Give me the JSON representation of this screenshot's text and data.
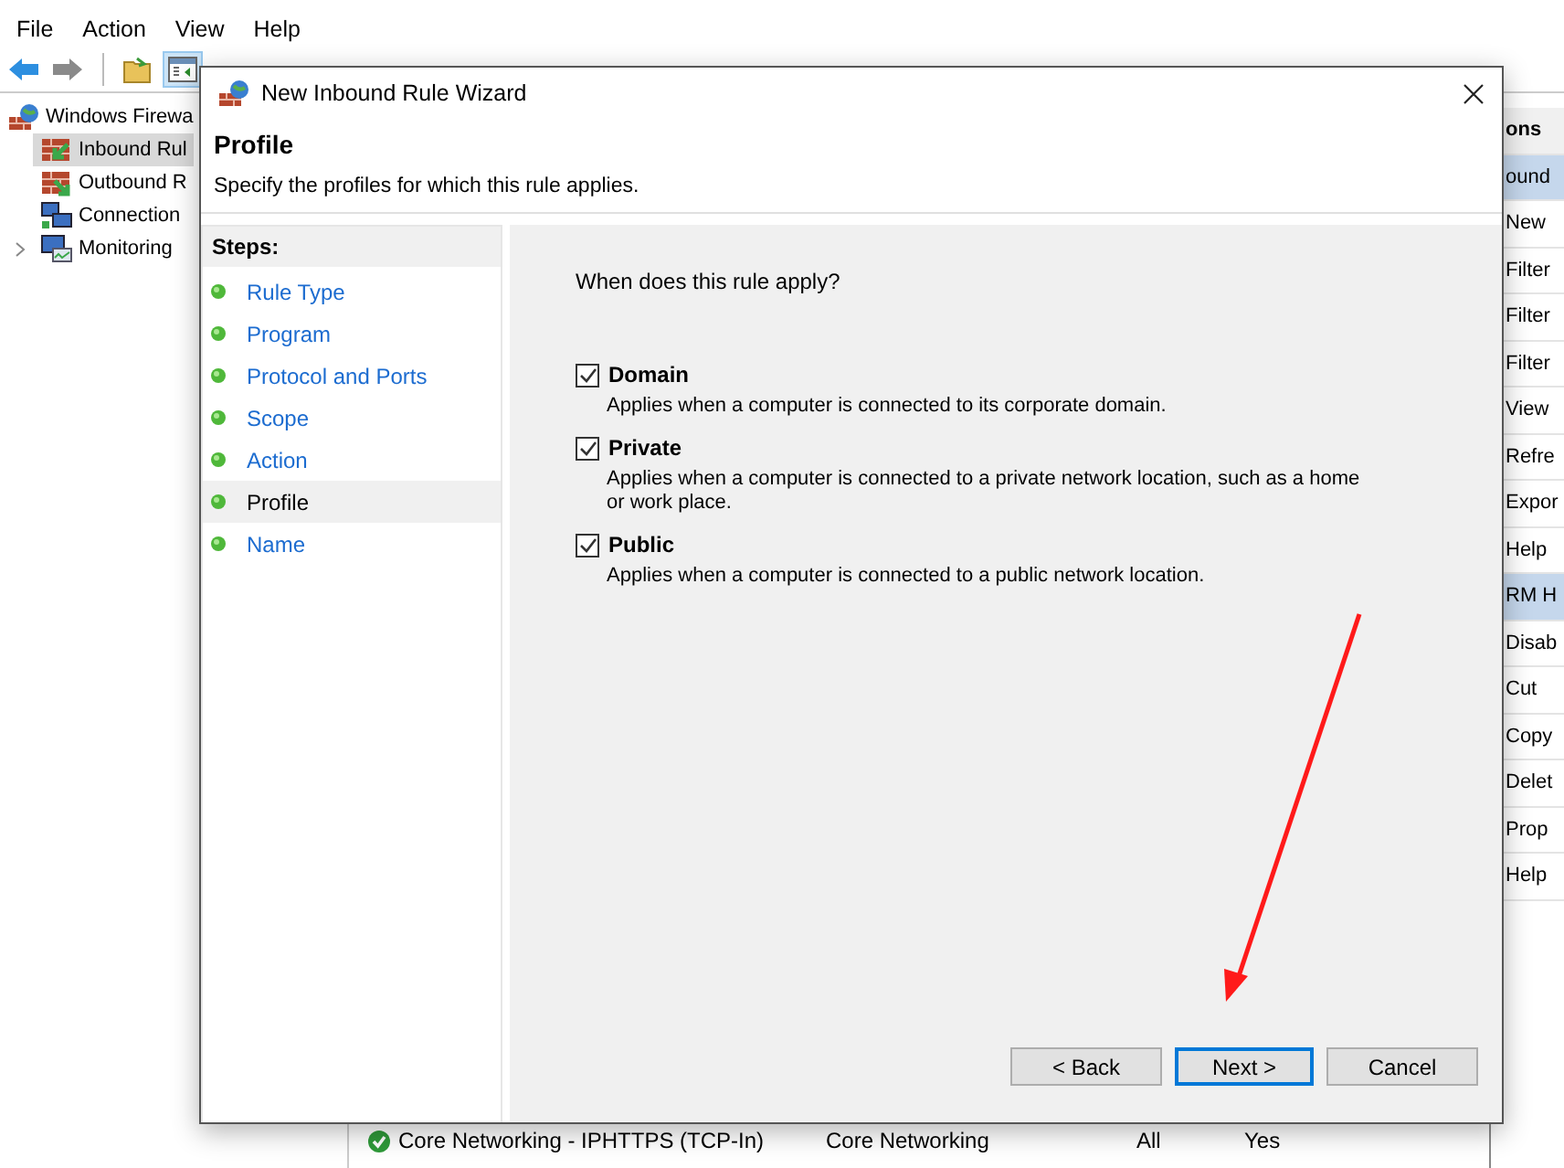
{
  "menu_bar": [
    "File",
    "Action",
    "View",
    "Help"
  ],
  "tree": [
    {
      "label": "Windows Firewa",
      "selected": false,
      "expanded": true,
      "children": [
        {
          "label": "Inbound Rul",
          "selected": true,
          "kind": "inbound"
        },
        {
          "label": "Outbound R",
          "selected": false,
          "kind": "outbound"
        },
        {
          "label": "Connection",
          "selected": false,
          "kind": "connection"
        },
        {
          "label": "Monitoring",
          "selected": false,
          "kind": "monitoring",
          "expandable": true
        }
      ]
    }
  ],
  "rules_list": [
    {
      "name": "Core Networking - IPHTTPS (TCP-In)",
      "group": "Core Networking",
      "profile": "All",
      "enabled": "Yes"
    }
  ],
  "actions_pane": {
    "title": "ons",
    "items": [
      {
        "kind": "section",
        "label": "ound"
      },
      {
        "kind": "item",
        "label": "New"
      },
      {
        "kind": "item",
        "label": "Filter"
      },
      {
        "kind": "item",
        "label": "Filter"
      },
      {
        "kind": "item",
        "label": "Filter"
      },
      {
        "kind": "item",
        "label": "View"
      },
      {
        "kind": "item",
        "label": "Refre"
      },
      {
        "kind": "item",
        "label": "Expor"
      },
      {
        "kind": "item",
        "label": "Help"
      },
      {
        "kind": "section",
        "label": "RM H"
      },
      {
        "kind": "item",
        "label": "Disab"
      },
      {
        "kind": "item",
        "label": "Cut"
      },
      {
        "kind": "item",
        "label": "Copy"
      },
      {
        "kind": "item",
        "label": "Delet"
      },
      {
        "kind": "item",
        "label": "Prop"
      },
      {
        "kind": "item",
        "label": "Help"
      }
    ]
  },
  "dialog": {
    "title": "New Inbound Rule Wizard",
    "heading": "Profile",
    "subtitle": "Specify the profiles for which this rule applies.",
    "steps_title": "Steps:",
    "steps": [
      {
        "label": "Rule Type",
        "selected": false
      },
      {
        "label": "Program",
        "selected": false
      },
      {
        "label": "Protocol and Ports",
        "selected": false
      },
      {
        "label": "Scope",
        "selected": false
      },
      {
        "label": "Action",
        "selected": false
      },
      {
        "label": "Profile",
        "selected": true
      },
      {
        "label": "Name",
        "selected": false
      }
    ],
    "question": "When does this rule apply?",
    "profiles": [
      {
        "label": "Domain",
        "checked": true,
        "description": "Applies when a computer is connected to its corporate domain."
      },
      {
        "label": "Private",
        "checked": true,
        "description": "Applies when a computer is connected to a private network location, such as a home or work place."
      },
      {
        "label": "Public",
        "checked": true,
        "description": "Applies when a computer is connected to a public network location."
      }
    ],
    "buttons": [
      {
        "label": "< Back",
        "focused": false
      },
      {
        "label": "Next >",
        "focused": true
      },
      {
        "label": "Cancel",
        "focused": false
      }
    ]
  },
  "annotation": {
    "kind": "arrow",
    "color": "#ff1a1a"
  }
}
